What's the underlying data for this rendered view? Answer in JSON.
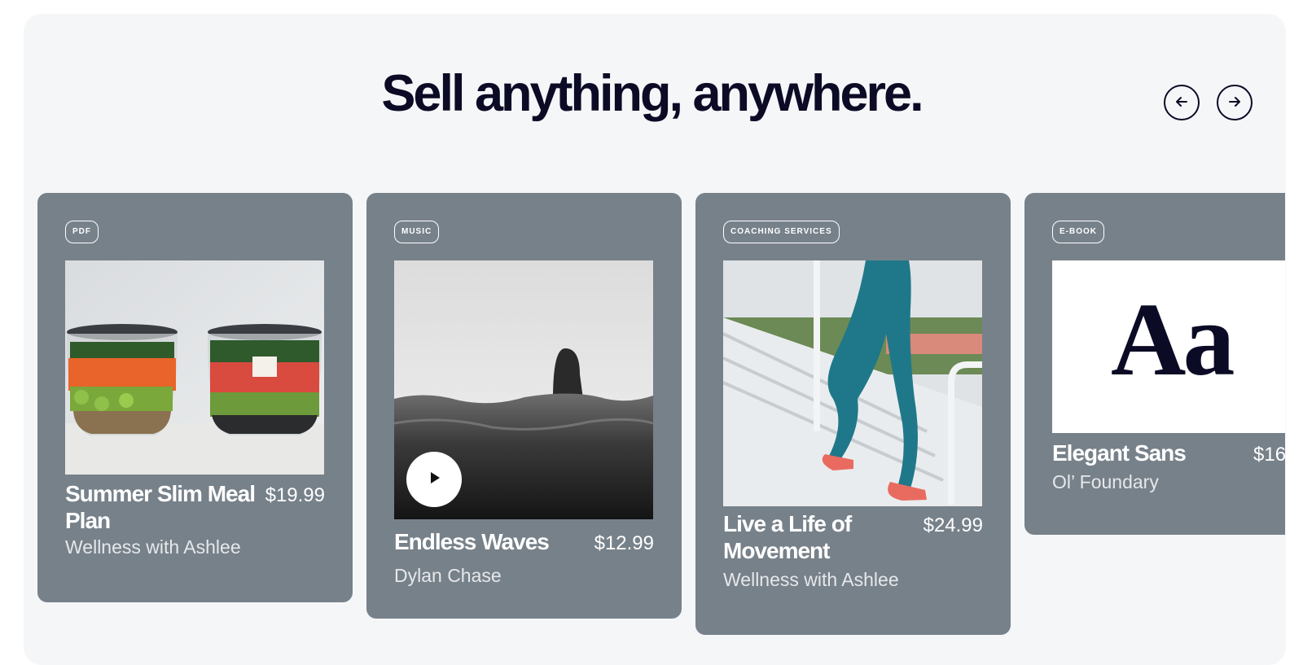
{
  "headline": "Sell anything, anywhere.",
  "nav": {
    "prev_icon": "arrow-left-icon",
    "next_icon": "arrow-right-icon"
  },
  "products": [
    {
      "badge": "PDF",
      "title": "Summer Slim Meal Plan",
      "price": "$19.99",
      "author": "Wellness with Ashlee"
    },
    {
      "badge": "MUSIC",
      "title": "Endless Waves",
      "price": "$12.99",
      "author": "Dylan Chase"
    },
    {
      "badge": "COACHING SERVICES",
      "title": "Live a Life of Movement",
      "price": "$24.99",
      "author": "Wellness with Ashlee"
    },
    {
      "badge": "E-BOOK",
      "title": "Elegant Sans",
      "price": "$16",
      "author": "Ol’ Foundary",
      "specimen": "Aa"
    }
  ],
  "colors": {
    "card": "#77818a",
    "panel": "#f5f6f8",
    "headline": "#0c0b26"
  }
}
